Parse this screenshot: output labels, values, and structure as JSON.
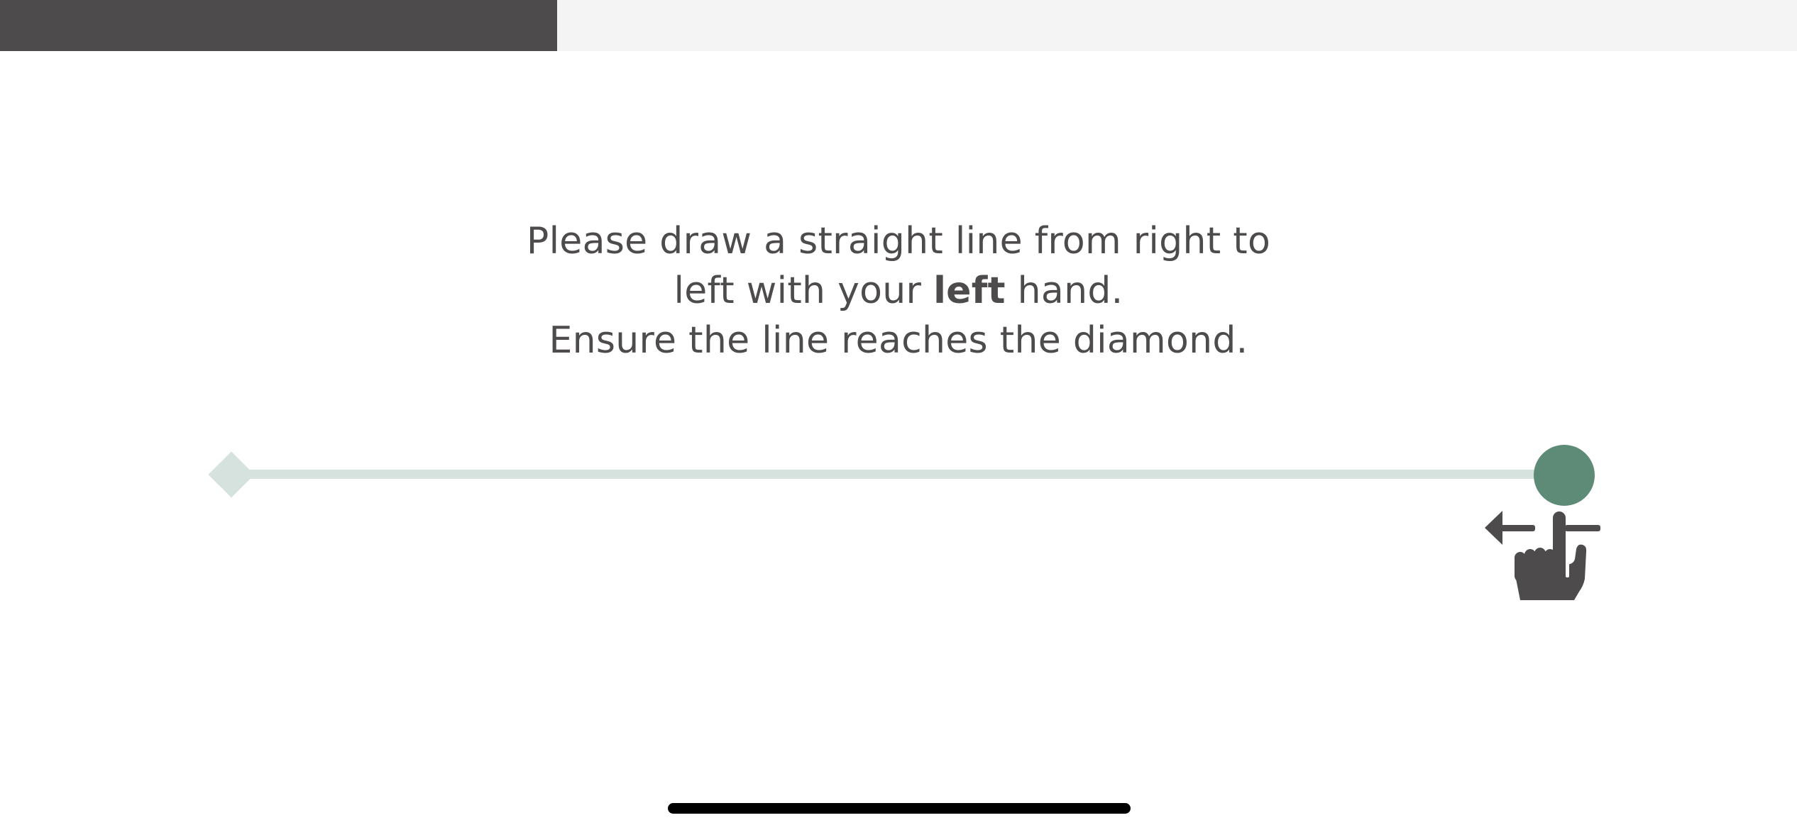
{
  "progress": {
    "fraction": 0.31
  },
  "instructions": {
    "line1": "Please draw a straight line from right to",
    "line2_before": "left with your ",
    "line2_bold": "left",
    "line2_after": " hand.",
    "line3": "Ensure the line reaches the diamond."
  },
  "tracing": {
    "direction": "right-to-left",
    "start_marker_icon": "circle",
    "target_marker_icon": "diamond",
    "hint_icon": "swipe-left-hand-icon"
  },
  "colors": {
    "text": "#4e4b4c",
    "progress_fill": "#4e4b4c",
    "progress_track": "#f4f4f4",
    "line": "#d6e2dd",
    "start_dot": "#5e8a78"
  }
}
